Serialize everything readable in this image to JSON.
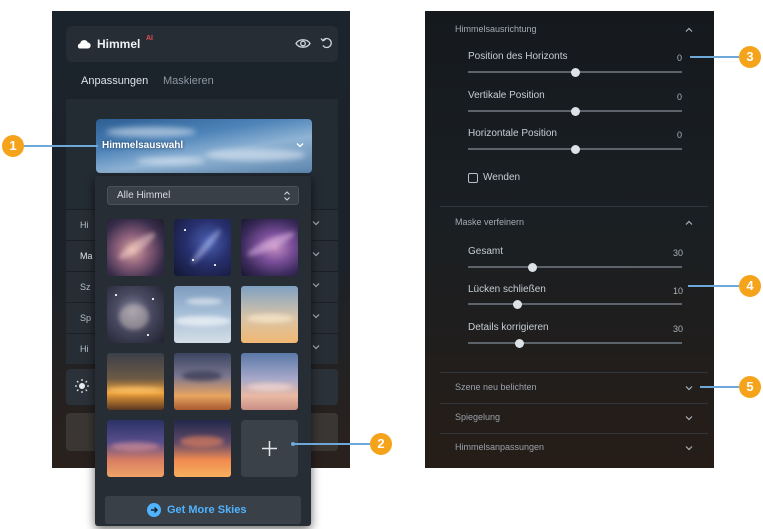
{
  "left": {
    "panel_title": "Himmel",
    "ai_badge": "AI",
    "tabs": [
      {
        "label": "Anpassungen"
      },
      {
        "label": "Maskieren"
      }
    ],
    "sky_selector_label": "Himmelsauswahl",
    "sky_rows": [
      {
        "label": "Hi"
      },
      {
        "label": "Ma"
      },
      {
        "label": "Sz"
      },
      {
        "label": "Sp"
      },
      {
        "label": "Hi"
      }
    ],
    "dropdown": {
      "select_value": "Alle Himmel",
      "thumbnails": [
        "galaxy-pink",
        "galaxy-blue",
        "galaxy-violet",
        "milky-way-dark",
        "cloudy-blue",
        "sunset-warm",
        "sunset-dark",
        "sunset-orange",
        "dusk-pink",
        "evening-violet",
        "evening-orange"
      ],
      "get_more_label": "Get More Skies"
    }
  },
  "right": {
    "sections": [
      {
        "title": "Himmelsausrichtung",
        "params": [
          {
            "label": "Position des Horizonts",
            "value": "0",
            "fraction": 0.5
          },
          {
            "label": "Vertikale Position",
            "value": "0",
            "fraction": 0.5
          },
          {
            "label": "Horizontale Position",
            "value": "0",
            "fraction": 0.5
          }
        ],
        "checkbox_label": "Wenden"
      },
      {
        "title": "Maske verfeinern",
        "params": [
          {
            "label": "Gesamt",
            "value": "30",
            "fraction": 0.3
          },
          {
            "label": "Lücken schließen",
            "value": "10",
            "fraction": 0.23
          },
          {
            "label": "Details korrigieren",
            "value": "30",
            "fraction": 0.24
          }
        ]
      }
    ],
    "collapsed_sections": [
      {
        "title": "Szene neu belichten"
      },
      {
        "title": "Spiegelung"
      },
      {
        "title": "Himmelsanpassungen"
      }
    ]
  },
  "callouts": [
    "1",
    "2",
    "3",
    "4",
    "5"
  ],
  "colors": {
    "callout": "#f5a31a",
    "callout_line": "#6ea8d9",
    "link_blue": "#4fb3ff"
  }
}
